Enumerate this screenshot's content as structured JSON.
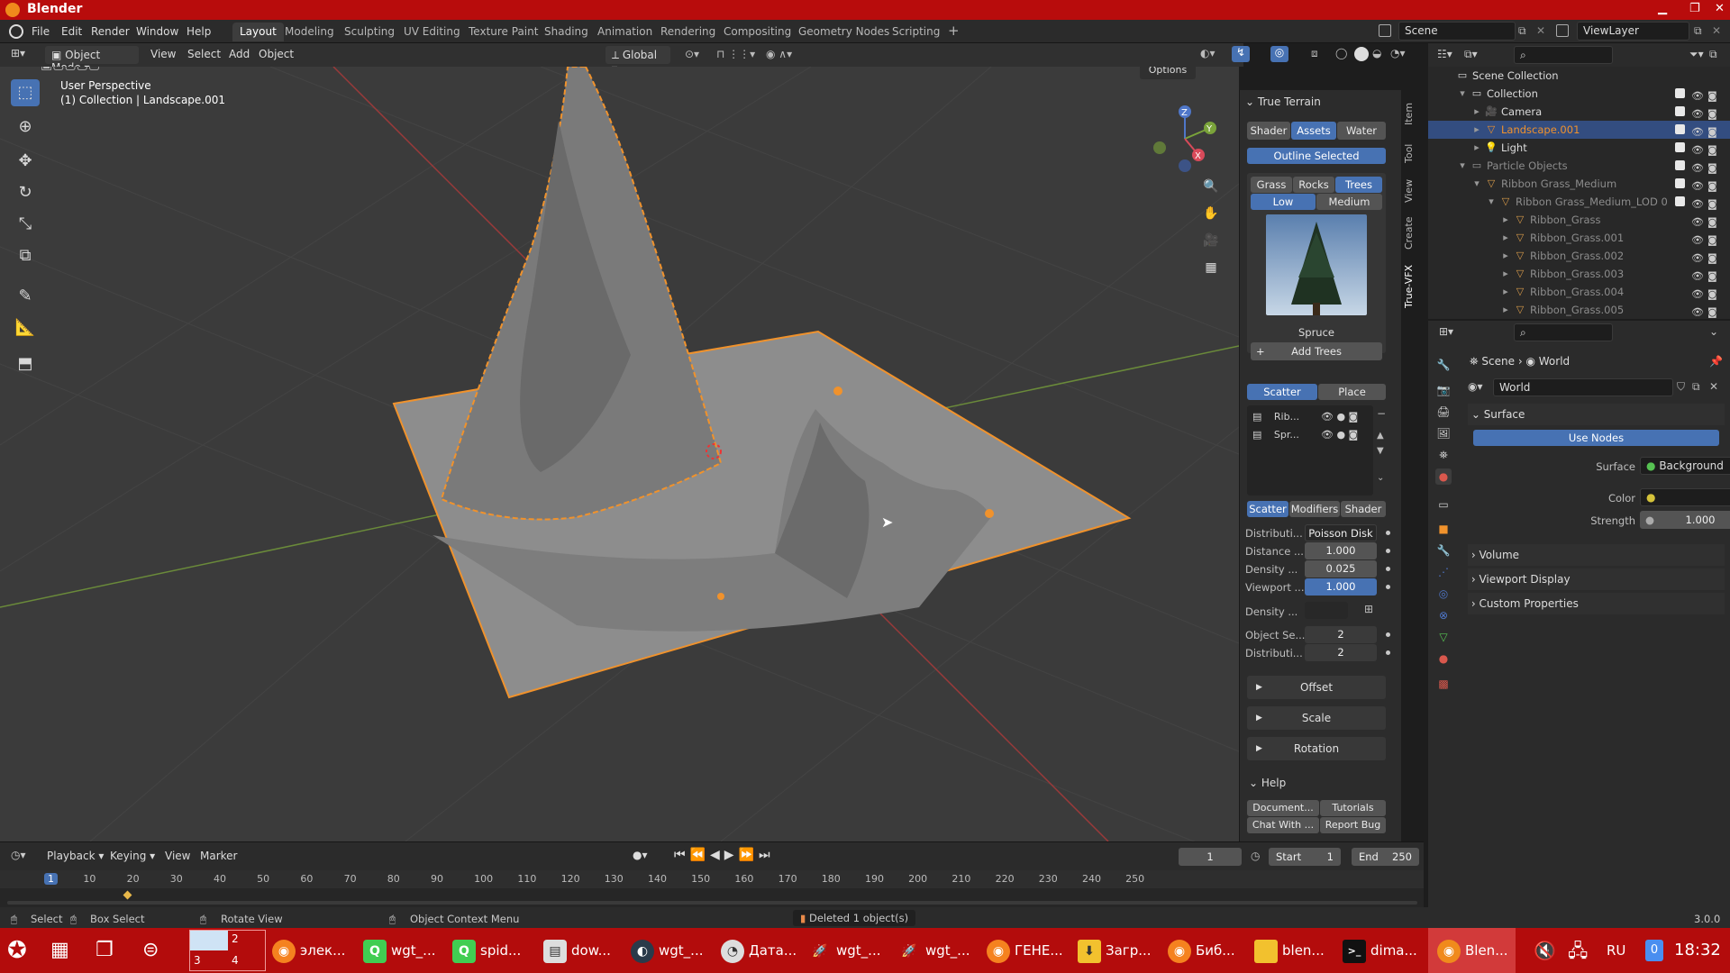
{
  "window": {
    "title": "Blender"
  },
  "menu": [
    "File",
    "Edit",
    "Render",
    "Window",
    "Help"
  ],
  "workspaces": [
    "Layout",
    "Modeling",
    "Sculpting",
    "UV Editing",
    "Texture Paint",
    "Shading",
    "Animation",
    "Rendering",
    "Compositing",
    "Geometry Nodes",
    "Scripting"
  ],
  "active_workspace": "Layout",
  "scene": {
    "name": "Scene"
  },
  "view_layer": {
    "name": "ViewLayer"
  },
  "viewport_header": {
    "mode": "Object Mode",
    "menus": [
      "View",
      "Select",
      "Add",
      "Object"
    ],
    "orientation": "Global",
    "options": "Options"
  },
  "viewport": {
    "perspective": "User Perspective",
    "collection": "(1) Collection | Landscape.001",
    "axes": [
      "X",
      "Y",
      "Z"
    ]
  },
  "true_terrain": {
    "title": "True Terrain",
    "tabs": [
      "Shader",
      "Assets",
      "Water"
    ],
    "active_tab": "Assets",
    "outline_btn": "Outline Selected",
    "asset_types": [
      "Grass",
      "Rocks",
      "Trees"
    ],
    "active_asset_type": "Trees",
    "quality": [
      "Low",
      "Medium"
    ],
    "active_quality": "Low",
    "asset_name": "Spruce",
    "add_btn": "Add Trees",
    "modes": [
      "Scatter",
      "Place"
    ],
    "list": [
      "Rib...",
      "Spr..."
    ],
    "sub_tabs": [
      "Scatter",
      "Modifiers",
      "Shader"
    ],
    "props": [
      {
        "label": "Distributi...",
        "value": "Poisson Disk"
      },
      {
        "label": "Distance ...",
        "value": "1.000"
      },
      {
        "label": "Density ...",
        "value": "0.025"
      },
      {
        "label": "Viewport ...",
        "value": "1.000"
      },
      {
        "label": "Density ...",
        "value": ""
      },
      {
        "label": "Object Se...",
        "value": "2"
      },
      {
        "label": "Distributi...",
        "value": "2"
      }
    ],
    "sections": [
      "Offset",
      "Scale",
      "Rotation"
    ],
    "help": "Help",
    "help_btns": [
      "Document...",
      "Tutorials",
      "Chat With ...",
      "Report Bug"
    ]
  },
  "side_tabs": [
    "Item",
    "Tool",
    "View",
    "Create",
    "True-VFX"
  ],
  "outliner": {
    "rows": [
      {
        "label": "Scene Collection",
        "indent": 0
      },
      {
        "label": "Collection",
        "indent": 1
      },
      {
        "label": "Camera",
        "indent": 2
      },
      {
        "label": "Landscape.001",
        "indent": 2
      },
      {
        "label": "Light",
        "indent": 2
      },
      {
        "label": "Particle Objects",
        "indent": 1
      },
      {
        "label": "Ribbon Grass_Medium",
        "indent": 2
      },
      {
        "label": "Ribbon Grass_Medium_LOD 0",
        "indent": 3
      },
      {
        "label": "Ribbon_Grass",
        "indent": 4
      },
      {
        "label": "Ribbon_Grass.001",
        "indent": 4
      },
      {
        "label": "Ribbon_Grass.002",
        "indent": 4
      },
      {
        "label": "Ribbon_Grass.003",
        "indent": 4
      },
      {
        "label": "Ribbon_Grass.004",
        "indent": 4
      },
      {
        "label": "Ribbon_Grass.005",
        "indent": 4
      }
    ]
  },
  "properties": {
    "breadcrumb": [
      "Scene",
      "World"
    ],
    "world_name": "World",
    "surface_section": "Surface",
    "use_nodes": "Use Nodes",
    "surface_label": "Surface",
    "surface_value": "Background",
    "color_label": "Color",
    "strength_label": "Strength",
    "strength_value": "1.000",
    "collapsed": [
      "Volume",
      "Viewport Display",
      "Custom Properties"
    ]
  },
  "timeline": {
    "menus": [
      "Playback",
      "Keying",
      "View",
      "Marker"
    ],
    "current_frame": "1",
    "start_label": "Start",
    "start": "1",
    "end_label": "End",
    "end": "250",
    "ticks": [
      "1",
      "10",
      "20",
      "30",
      "40",
      "50",
      "60",
      "70",
      "80",
      "90",
      "100",
      "110",
      "120",
      "130",
      "140",
      "150",
      "160",
      "170",
      "180",
      "190",
      "200",
      "210",
      "220",
      "230",
      "240",
      "250"
    ]
  },
  "status": {
    "select": "Select",
    "box_select": "Box Select",
    "rotate": "Rotate View",
    "context_menu": "Object Context Menu",
    "message": "Deleted 1 object(s)",
    "version": "3.0.0"
  },
  "taskbar": {
    "workspaces": [
      "2",
      "3",
      "4"
    ],
    "items": [
      "элек...",
      "wgt_...",
      "spid...",
      "dow...",
      "wgt_...",
      "Дата...",
      "wgt_...",
      "wgt_...",
      "ГЕНЕ...",
      "Загр...",
      "Биб...",
      "blen...",
      "dima...",
      "Blen..."
    ],
    "lang": "RU",
    "notif": "0",
    "clock": "18:32"
  }
}
